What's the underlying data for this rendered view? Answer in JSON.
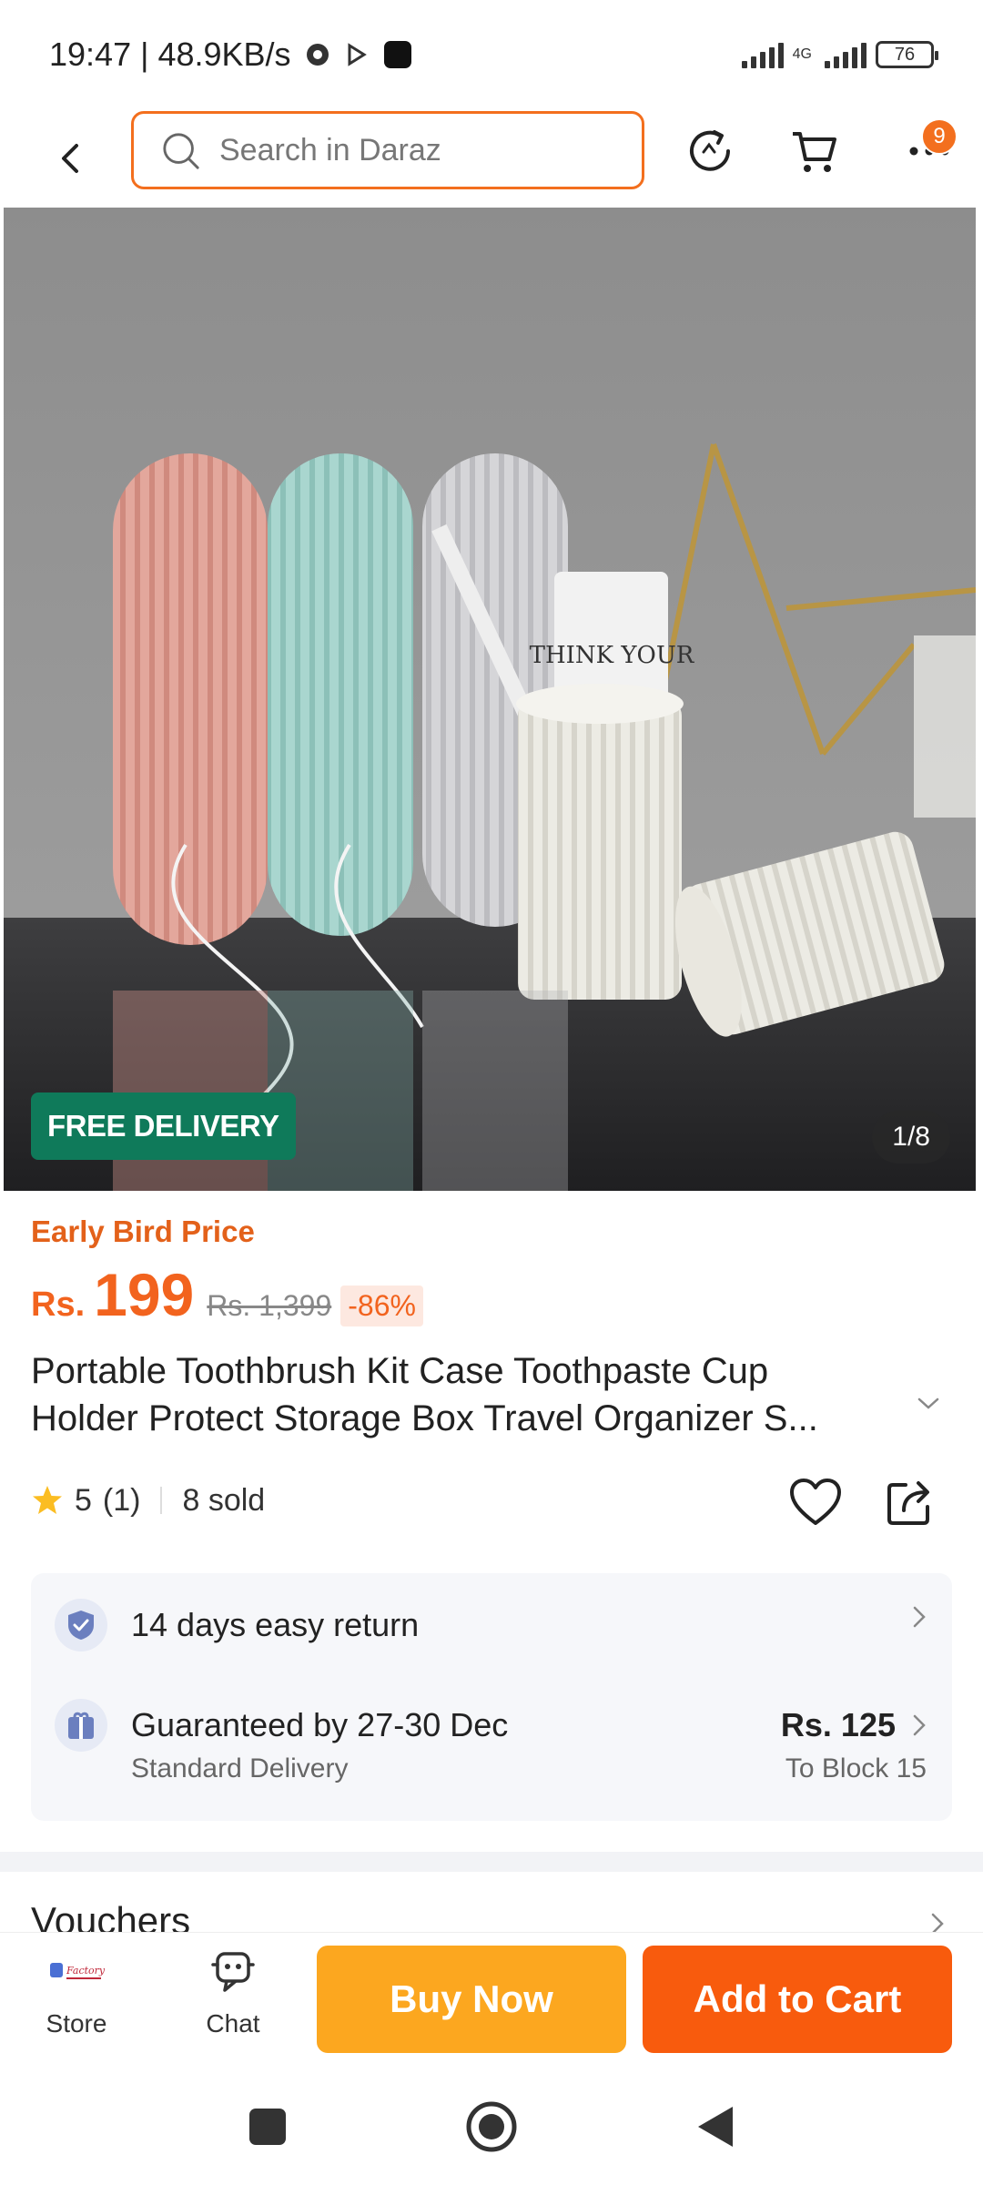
{
  "status_bar": {
    "time_speed": "19:47 | 48.9KB/s",
    "network_label": "4G",
    "battery": "76"
  },
  "header": {
    "search_placeholder": "Search in Daraz",
    "notification_count": "9"
  },
  "gallery": {
    "badge": "FREE DELIVERY",
    "counter": "1/8",
    "think_text": "THINK YOUR"
  },
  "pricing": {
    "promo_label": "Early Bird Price",
    "currency": "Rs.",
    "price": "199",
    "original_price": "Rs. 1,399",
    "discount": "-86%"
  },
  "product": {
    "title_line1": "Portable Toothbrush Kit Case Toothpaste Cup",
    "title_line2": "Holder Protect Storage Box Travel Organizer S...",
    "rating": "5",
    "rating_count": "(1)",
    "sold": "8 sold"
  },
  "services": {
    "return_text": "14 days easy return",
    "delivery_text": "Guaranteed by 27-30 Dec",
    "delivery_type": "Standard Delivery",
    "delivery_price": "Rs. 125",
    "delivery_location": "To Block 15"
  },
  "sections": {
    "vouchers": "Vouchers"
  },
  "bottom_bar": {
    "store_label": "Store",
    "chat_label": "Chat",
    "buy_now": "Buy Now",
    "add_to_cart": "Add to Cart"
  },
  "colors": {
    "brand_orange": "#f85b0d",
    "buy_now_yellow": "#fca71f",
    "free_delivery_green": "#0f7a5a"
  }
}
